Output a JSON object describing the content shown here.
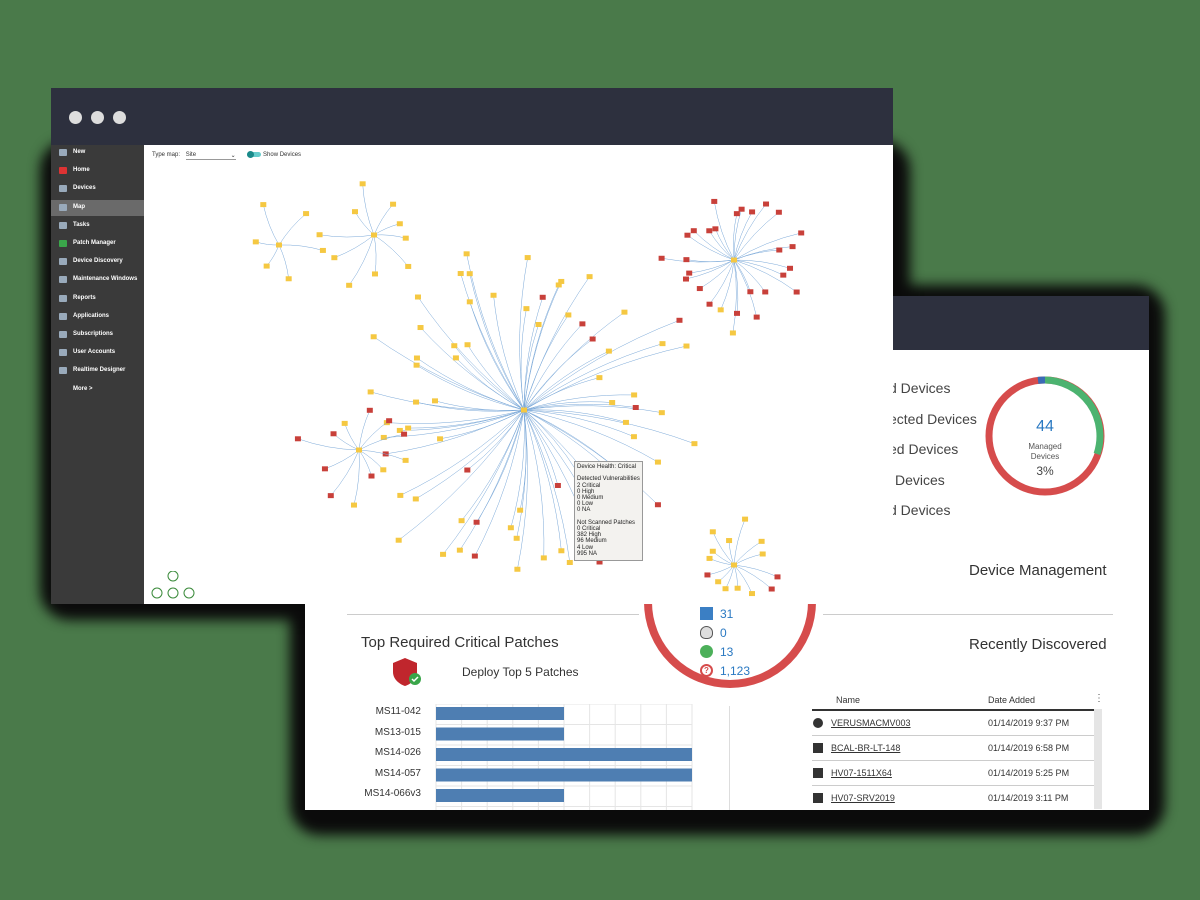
{
  "dashboard": {
    "device_management": {
      "title": "Device Management",
      "labels": [
        "d Devices",
        "ected Devices",
        "ed Devices",
        "Devices",
        "d Devices"
      ],
      "donut": {
        "value": "44",
        "caption": "Managed Devices",
        "percent": "3%",
        "fraction": 0.03,
        "colors": {
          "main": "#d64c4c",
          "managed": "#4cb370",
          "accent": "#3a6bb5"
        }
      }
    },
    "os_counts": [
      {
        "icon": "windows-icon",
        "count": "31"
      },
      {
        "icon": "linux-icon",
        "count": "0"
      },
      {
        "icon": "apple-icon",
        "count": "13"
      },
      {
        "icon": "unknown-icon",
        "count": "1,123"
      }
    ],
    "patches": {
      "title": "Top Required Critical Patches",
      "deploy_label": "Deploy Top 5 Patches",
      "chart_data": {
        "type": "bar",
        "categories": [
          "MS11-042",
          "MS13-015",
          "MS14-026",
          "MS14-057",
          "MS14-066v3"
        ],
        "values": [
          5,
          5,
          10,
          10,
          5
        ],
        "xlim": [
          0,
          10
        ]
      }
    },
    "recent": {
      "title": "Recently Discovered",
      "columns": [
        "Name",
        "Date Added"
      ],
      "rows": [
        {
          "icon": "apple-icon",
          "name": "VERUSMACMV003",
          "date": "01/14/2019 9:37 PM"
        },
        {
          "icon": "windows-icon",
          "name": "BCAL-BR-LT-148",
          "date": "01/14/2019 6:58 PM"
        },
        {
          "icon": "windows-icon",
          "name": "HV07-1511X64",
          "date": "01/14/2019 5:25 PM"
        },
        {
          "icon": "windows-icon",
          "name": "HV07-SRV2019",
          "date": "01/14/2019 3:11 PM"
        }
      ]
    }
  },
  "map_window": {
    "sidebar": [
      {
        "label": "New",
        "icon": "plus-icon"
      },
      {
        "label": "Home",
        "icon": "home-icon"
      },
      {
        "label": "Devices",
        "icon": "monitor-icon"
      },
      {
        "label": "Map",
        "icon": "map-icon",
        "active": true
      },
      {
        "label": "Tasks",
        "icon": "calendar-icon"
      },
      {
        "label": "Patch Manager",
        "icon": "shield-icon"
      },
      {
        "label": "Device Discovery",
        "icon": "discovery-icon"
      },
      {
        "label": "Maintenance Windows",
        "icon": "tools-icon"
      },
      {
        "label": "Reports",
        "icon": "chart-icon"
      },
      {
        "label": "Applications",
        "icon": "apps-icon"
      },
      {
        "label": "Subscriptions",
        "icon": "tag-icon"
      },
      {
        "label": "User Accounts",
        "icon": "user-icon"
      },
      {
        "label": "Realtime Designer",
        "icon": "designer-icon"
      },
      {
        "label": "More >",
        "icon": ""
      }
    ],
    "toolbar": {
      "type_map_label": "Type map:",
      "type_map_value": "Site",
      "toggle_label": "Show Devices"
    },
    "tooltip": {
      "lines": [
        "Device Health: Critical",
        "",
        "Detected Vulnerabilities",
        "2 Critical",
        "0 High",
        "0 Medium",
        "0 Low",
        "0 NA",
        "",
        "Not Scanned Patches",
        "0 Critical",
        "382 High",
        "96 Medium",
        "4 Low",
        "995 NA"
      ]
    },
    "colors": {
      "folder": "#f5c842",
      "windows_node": "#c8403a",
      "link": "#7aa8d8"
    }
  }
}
